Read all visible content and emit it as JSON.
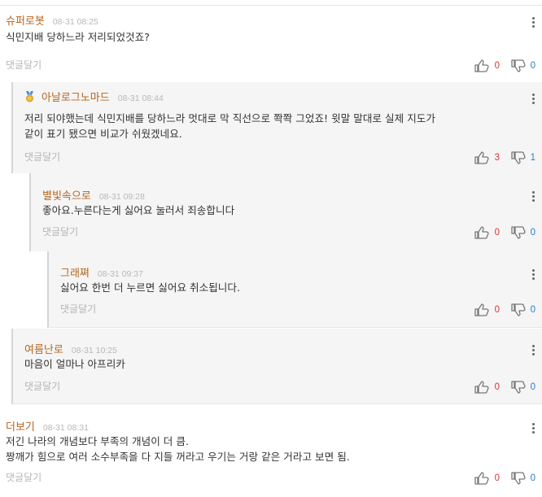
{
  "reply_label": "댓글달기",
  "colors": {
    "author": "#b5651d",
    "upvote": "#dd3333",
    "downvote": "#2a7bd5"
  },
  "comments": [
    {
      "author": "슈퍼로봇",
      "time": "08-31 08:25",
      "lines": [
        "식민지배 당하느라 저리되었것죠?"
      ],
      "up": "0",
      "down": "0"
    },
    {
      "author": "아날로그노마드",
      "time": "08-31 08:44",
      "badge": "medal-icon",
      "lines": [
        "저리 되야했는데 식민지배를 당하느라 멋대로 막 직선으로 쫙쫙 그었죠! 윗말 말대로 실제 지도가",
        "같이 표기 됐으면 비교가 쉬웠겠네요."
      ],
      "up": "3",
      "down": "1"
    },
    {
      "author": "별빛속으로",
      "time": "08-31 09:28",
      "lines": [
        "좋아요.누른다는게 싫어요 눌러서 죄송합니다"
      ],
      "up": "0",
      "down": "0"
    },
    {
      "author": "그래쪄",
      "time": "08-31 09:37",
      "lines": [
        "싫어요 한번 더 누르면 싫어요 취소됩니다."
      ],
      "up": "0",
      "down": "0"
    },
    {
      "author": "여름난로",
      "time": "08-31 10:25",
      "lines": [
        "마음이 얼마나 아프리카"
      ],
      "up": "0",
      "down": "0"
    },
    {
      "author": "더보기",
      "time": "08-31 08:31",
      "lines": [
        "저긴 나라의 개념보다 부족의 개념이 더 큼.",
        "짱깨가 힘으로 여러 소수부족을 다 지들 꺼라고 우기는 거랑 같은 거라고 보면 됨."
      ],
      "up": "0",
      "down": "0"
    }
  ]
}
